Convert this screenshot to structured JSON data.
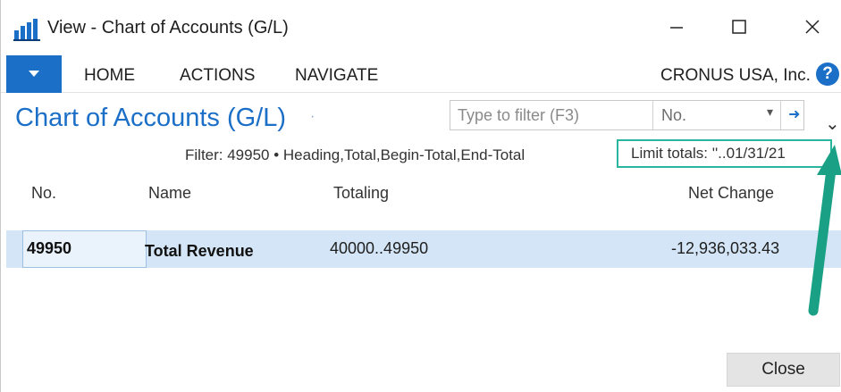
{
  "window": {
    "title": "View - Chart of Accounts (G/L)",
    "icon": "chart-app-icon",
    "controls": {
      "minimize": "minimize-icon",
      "maximize": "maximize-icon",
      "close": "close-icon"
    }
  },
  "ribbon": {
    "dropdown_icon": "caret-down-icon",
    "tabs": [
      {
        "label": "HOME"
      },
      {
        "label": "ACTIONS"
      },
      {
        "label": "NAVIGATE"
      }
    ],
    "company": "CRONUS USA, Inc.",
    "help": "?"
  },
  "page": {
    "title": "Chart of Accounts (G/L)",
    "title_dot": "·",
    "search": {
      "placeholder": "Type to filter (F3)",
      "field": "No.",
      "caret": "▾",
      "go": "➜"
    },
    "expand_chevron": "⌄",
    "filter_text": "Filter: 49950 • Heading,Total,Begin-Total,End-Total",
    "limit_totals": "Limit totals: ''..01/31/21"
  },
  "table": {
    "headers": {
      "no": "No.",
      "name": "Name",
      "totaling": "Totaling",
      "net_change": "Net Change"
    },
    "rows": [
      {
        "no": "49950",
        "name": "Total Revenue",
        "totaling": "40000..49950",
        "net_change": "-12,936,033.43"
      }
    ]
  },
  "footer": {
    "close_label": "Close"
  },
  "colors": {
    "accent": "#1b6fc7",
    "selected_row": "#d3e5f6",
    "highlight_box": "#2ab59e",
    "annotation_arrow": "#1aa084"
  }
}
